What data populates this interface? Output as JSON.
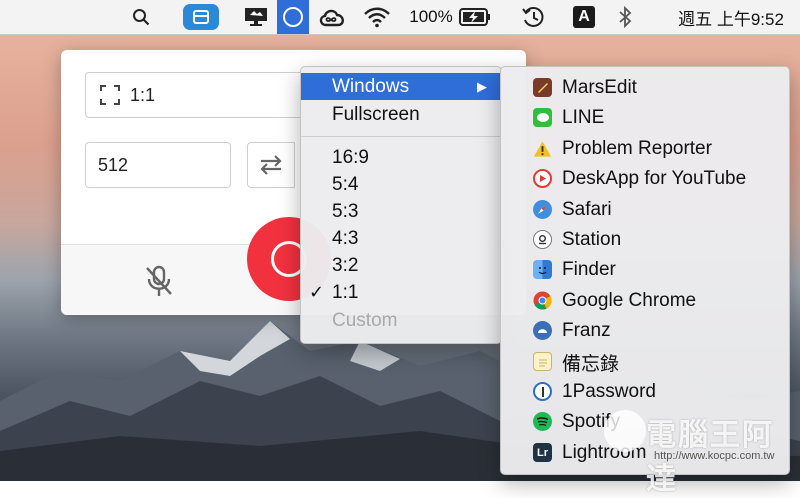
{
  "menubar": {
    "status_text": "100%",
    "clock": "週五 上午9:52",
    "input_method": "A"
  },
  "panel": {
    "ratio_value": "1:1",
    "size_value": "512"
  },
  "ratio_menu": {
    "items": [
      {
        "label": "Windows",
        "selected": true,
        "submenu": true
      },
      {
        "label": "Fullscreen"
      },
      {
        "label": "16:9"
      },
      {
        "label": "5:4"
      },
      {
        "label": "5:3"
      },
      {
        "label": "4:3"
      },
      {
        "label": "3:2"
      },
      {
        "label": "1:1",
        "checked": true,
        "check_mark": "✓"
      },
      {
        "label": "Custom",
        "disabled": true
      }
    ],
    "submenu_arrow": "▶"
  },
  "windows_menu": {
    "items": [
      {
        "label": "MarsEdit",
        "icon": "marsedit-icon",
        "color": "#7a3b2a"
      },
      {
        "label": "LINE",
        "icon": "line-icon",
        "color": "#2fbf3a"
      },
      {
        "label": "Problem Reporter",
        "icon": "warning-icon",
        "color": "#f2c21a"
      },
      {
        "label": "DeskApp for YouTube",
        "icon": "youtube-icon",
        "color": "#e53935"
      },
      {
        "label": "Safari",
        "icon": "safari-icon",
        "color": "#3f8fe0"
      },
      {
        "label": "Station",
        "icon": "station-icon",
        "color": "#555555"
      },
      {
        "label": "Finder",
        "icon": "finder-icon",
        "color": "#4a90e2"
      },
      {
        "label": "Google Chrome",
        "icon": "chrome-icon",
        "color": "#db4437"
      },
      {
        "label": "Franz",
        "icon": "franz-icon",
        "color": "#3b6fb6"
      },
      {
        "label": "備忘錄",
        "icon": "notes-icon",
        "color": "#f1d97a"
      },
      {
        "label": "1Password",
        "icon": "onepassword-icon",
        "color": "#2c6ec6"
      },
      {
        "label": "Spotify",
        "icon": "spotify-icon",
        "color": "#1db954"
      },
      {
        "label": "Lightroom",
        "icon": "lightroom-icon",
        "color": "#1f3347",
        "glyph": "Lr"
      }
    ]
  },
  "watermark": {
    "text": "電腦王阿達",
    "url": "http://www.kocpc.com.tw"
  },
  "colors": {
    "accent": "#2f6dd9",
    "record": "#f2313f"
  }
}
